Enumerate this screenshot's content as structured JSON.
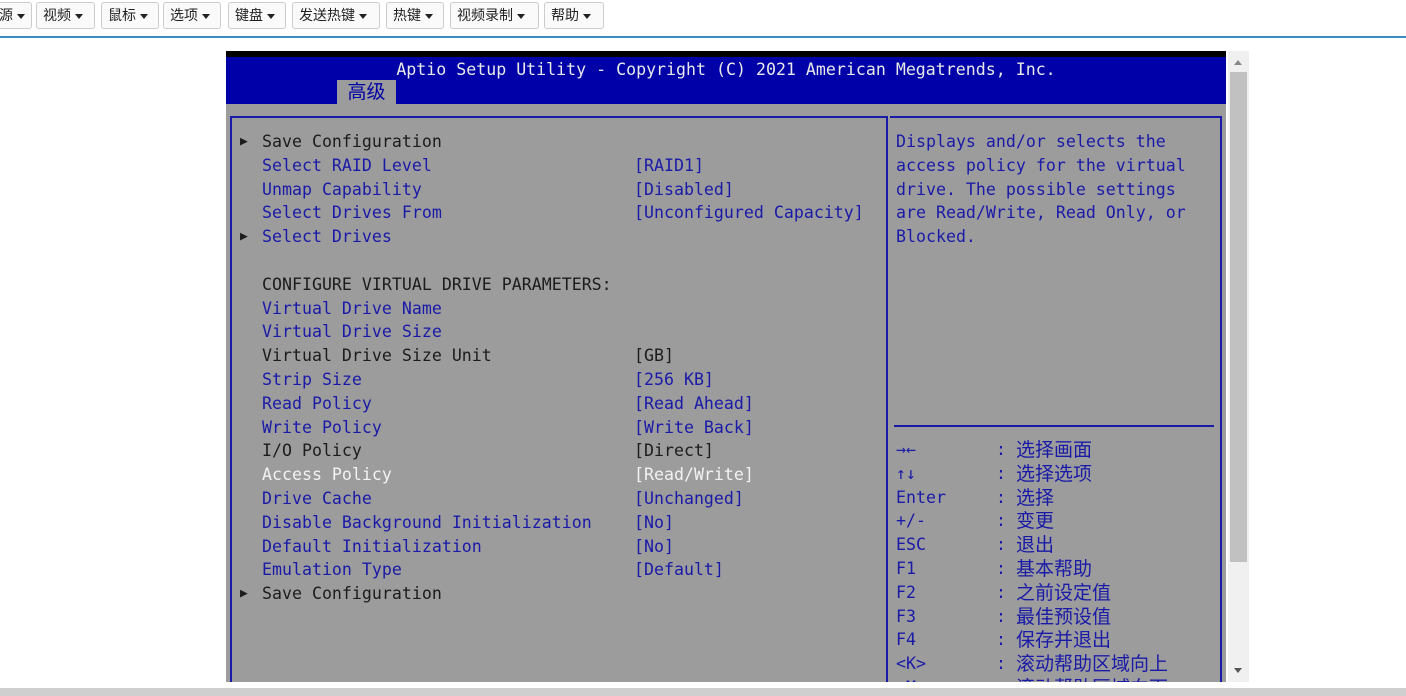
{
  "toolbar": {
    "items": [
      "源",
      "视频",
      "鼠标",
      "选项",
      "键盘",
      "发送热键",
      "热键",
      "视频录制",
      "帮助"
    ]
  },
  "bios": {
    "title": "Aptio Setup Utility - Copyright (C) 2021 American Megatrends, Inc.",
    "tab": "高级",
    "rows": [
      {
        "arrow": true,
        "label": "Save Configuration",
        "value": "",
        "style": "black"
      },
      {
        "arrow": false,
        "label": "Select RAID Level",
        "value": "[RAID1]",
        "style": "blue"
      },
      {
        "arrow": false,
        "label": "Unmap Capability",
        "value": "[Disabled]",
        "style": "blue"
      },
      {
        "arrow": false,
        "label": "Select Drives From",
        "value": "[Unconfigured Capacity]",
        "style": "blue"
      },
      {
        "arrow": true,
        "label": "Select Drives",
        "value": "",
        "style": "blue"
      },
      {
        "arrow": false,
        "label": "",
        "value": "",
        "style": "black"
      },
      {
        "arrow": false,
        "label": "CONFIGURE VIRTUAL DRIVE PARAMETERS:",
        "value": "",
        "style": "black"
      },
      {
        "arrow": false,
        "label": "Virtual Drive Name",
        "value": "",
        "style": "blue"
      },
      {
        "arrow": false,
        "label": "Virtual Drive Size",
        "value": "",
        "style": "blue"
      },
      {
        "arrow": false,
        "label": "Virtual Drive Size Unit",
        "value": "[GB]",
        "style": "black"
      },
      {
        "arrow": false,
        "label": "Strip Size",
        "value": "[256 KB]",
        "style": "blue"
      },
      {
        "arrow": false,
        "label": "Read Policy",
        "value": "[Read Ahead]",
        "style": "blue"
      },
      {
        "arrow": false,
        "label": "Write Policy",
        "value": "[Write Back]",
        "style": "blue"
      },
      {
        "arrow": false,
        "label": "I/O Policy",
        "value": "[Direct]",
        "style": "black"
      },
      {
        "arrow": false,
        "label": "Access Policy",
        "value": "[Read/Write]",
        "style": "white"
      },
      {
        "arrow": false,
        "label": "Drive Cache",
        "value": "[Unchanged]",
        "style": "blue"
      },
      {
        "arrow": false,
        "label": "Disable Background Initialization",
        "value": "[No]",
        "style": "blue"
      },
      {
        "arrow": false,
        "label": "Default Initialization",
        "value": "[No]",
        "style": "blue"
      },
      {
        "arrow": false,
        "label": "Emulation Type",
        "value": "[Default]",
        "style": "blue"
      },
      {
        "arrow": true,
        "label": "Save Configuration",
        "value": "",
        "style": "black"
      }
    ],
    "help_text": "Displays and/or selects the access policy for the virtual drive. The possible settings are Read/Write, Read Only, or Blocked.",
    "keys": [
      {
        "key": "→←",
        "desc": "选择画面"
      },
      {
        "key": "↑↓",
        "desc": "选择选项"
      },
      {
        "key": "Enter",
        "desc": "选择"
      },
      {
        "key": "+/-",
        "desc": "变更"
      },
      {
        "key": "ESC",
        "desc": "退出"
      },
      {
        "key": "F1",
        "desc": "基本帮助"
      },
      {
        "key": "F2",
        "desc": "之前设定值"
      },
      {
        "key": "F3",
        "desc": "最佳预设值"
      },
      {
        "key": "F4",
        "desc": "保存并退出"
      },
      {
        "key": "<K>",
        "desc": "滚动帮助区域向上"
      },
      {
        "key": "<M>",
        "desc": "滚动帮助区域向下"
      }
    ],
    "key_separator": ":"
  }
}
